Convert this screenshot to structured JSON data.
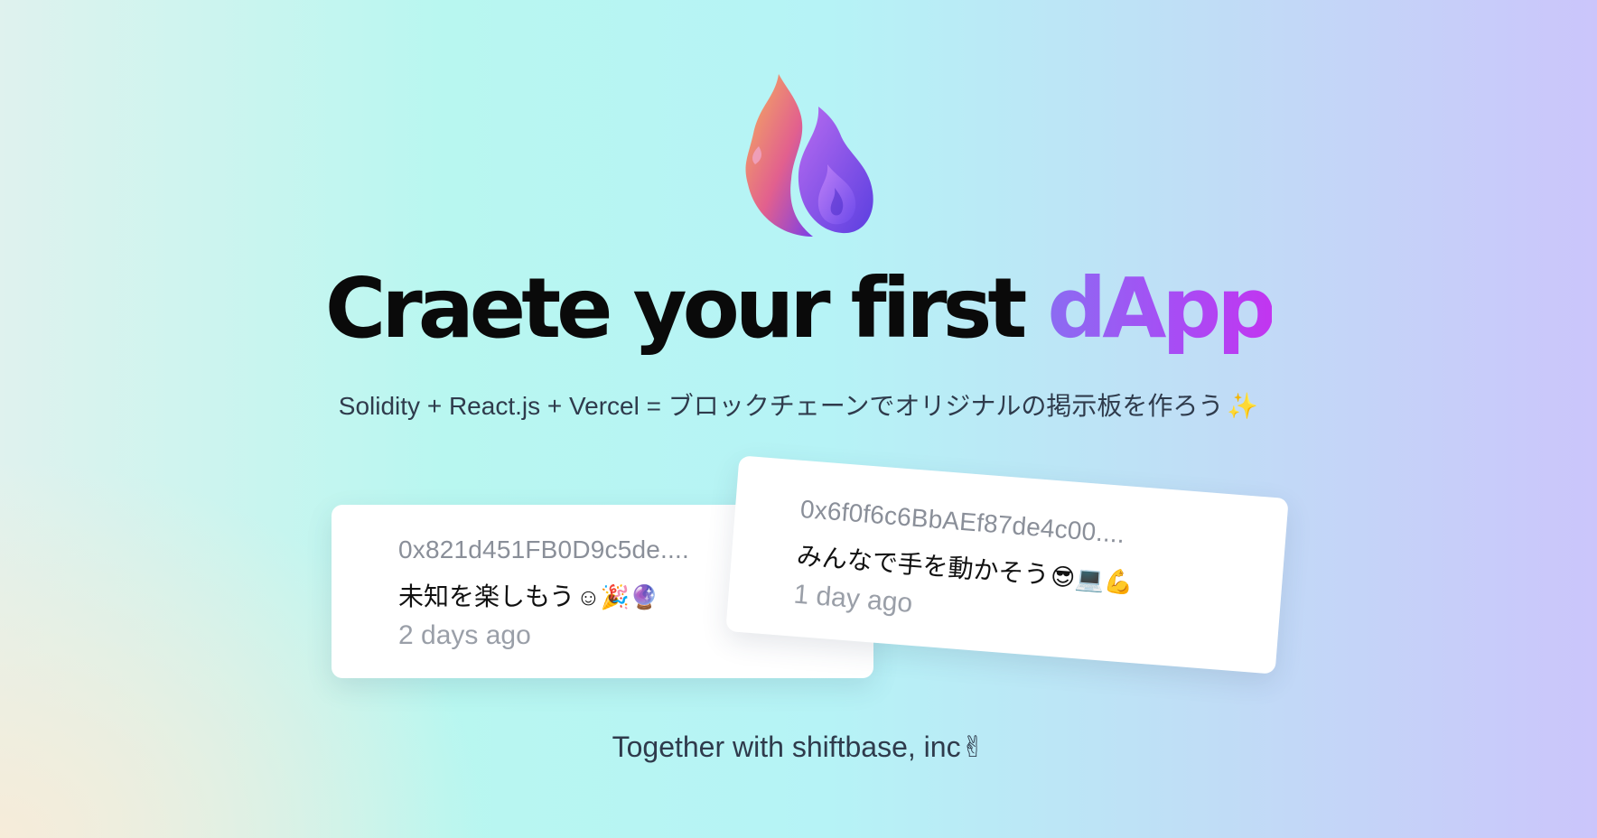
{
  "hero": {
    "logo_icon": "flame-icon",
    "headline_main": "Craete your first ",
    "headline_accent": "dApp",
    "tagline_text": "Solidity + React.js + Vercel = ブロックチェーンでオリジナルの掲示板を作ろう",
    "tagline_emoji": "✨"
  },
  "cards": [
    {
      "address": "0x821d451FB0D9c5de....",
      "message": "未知を楽しもう",
      "emojis": "☺🎉🔮",
      "time": "2 days ago"
    },
    {
      "address": "0x6f0f6c6BbAEf87de4c00....",
      "message": "みんなで手を動かそう",
      "emojis": "😎💻💪",
      "time": "1 day ago"
    }
  ],
  "footer": {
    "text": "Together with shiftbase, inc",
    "emoji": "✌"
  },
  "colors": {
    "accent_start": "#8b6cf2",
    "accent_end": "#c235f0",
    "headline": "#0a0a0a",
    "text": "#2f3b4c"
  }
}
